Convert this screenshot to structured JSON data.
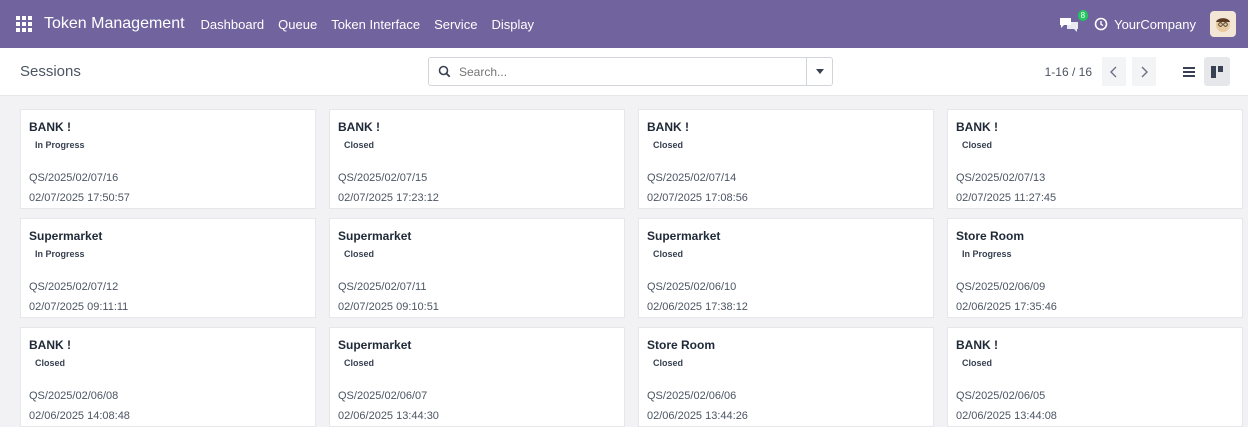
{
  "topbar": {
    "app_title": "Token Management",
    "nav": [
      "Dashboard",
      "Queue",
      "Token Interface",
      "Service",
      "Display"
    ],
    "chat_badge": "8",
    "company": "YourCompany",
    "accent_color": "#71639e"
  },
  "control": {
    "breadcrumb": "Sessions",
    "search_placeholder": "Search...",
    "pager": "1-16 / 16"
  },
  "cards": [
    {
      "name": "BANK !",
      "status": "In Progress",
      "code": "QS/2025/02/07/16",
      "date": "02/07/2025 17:50:57"
    },
    {
      "name": "BANK !",
      "status": "Closed",
      "code": "QS/2025/02/07/15",
      "date": "02/07/2025 17:23:12"
    },
    {
      "name": "BANK !",
      "status": "Closed",
      "code": "QS/2025/02/07/14",
      "date": "02/07/2025 17:08:56"
    },
    {
      "name": "BANK !",
      "status": "Closed",
      "code": "QS/2025/02/07/13",
      "date": "02/07/2025 11:27:45"
    },
    {
      "name": "Supermarket",
      "status": "In Progress",
      "code": "QS/2025/02/07/12",
      "date": "02/07/2025 09:11:11"
    },
    {
      "name": "Supermarket",
      "status": "Closed",
      "code": "QS/2025/02/07/11",
      "date": "02/07/2025 09:10:51"
    },
    {
      "name": "Supermarket",
      "status": "Closed",
      "code": "QS/2025/02/06/10",
      "date": "02/06/2025 17:38:12"
    },
    {
      "name": "Store Room",
      "status": "In Progress",
      "code": "QS/2025/02/06/09",
      "date": "02/06/2025 17:35:46"
    },
    {
      "name": "BANK !",
      "status": "Closed",
      "code": "QS/2025/02/06/08",
      "date": "02/06/2025 14:08:48"
    },
    {
      "name": "Supermarket",
      "status": "Closed",
      "code": "QS/2025/02/06/07",
      "date": "02/06/2025 13:44:30"
    },
    {
      "name": "Store Room",
      "status": "Closed",
      "code": "QS/2025/02/06/06",
      "date": "02/06/2025 13:44:26"
    },
    {
      "name": "BANK !",
      "status": "Closed",
      "code": "QS/2025/02/06/05",
      "date": "02/06/2025 13:44:08"
    }
  ]
}
